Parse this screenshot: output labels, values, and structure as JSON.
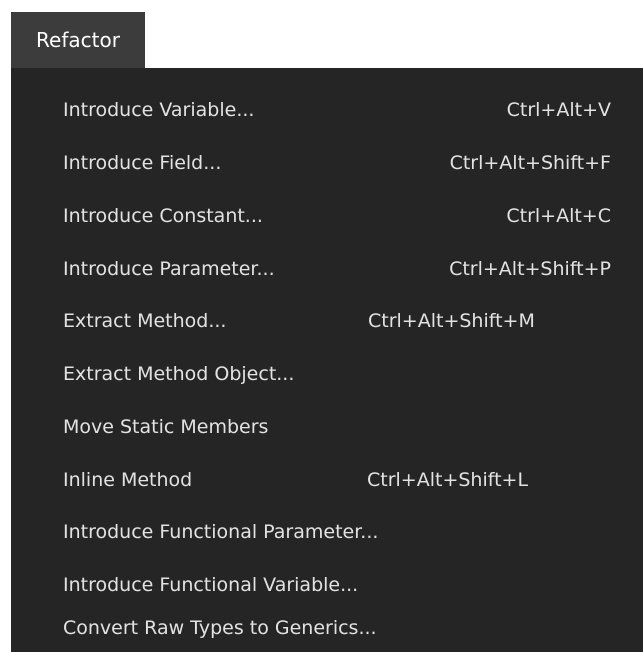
{
  "menu": {
    "title": "Refactor",
    "items": [
      {
        "label": "Introduce Variable...",
        "shortcut": "Ctrl+Alt+V"
      },
      {
        "label": "Introduce Field...",
        "shortcut": "Ctrl+Alt+Shift+F"
      },
      {
        "label": "Introduce Constant...",
        "shortcut": "Ctrl+Alt+C"
      },
      {
        "label": "Introduce Parameter...",
        "shortcut": "Ctrl+Alt+Shift+P"
      },
      {
        "label": "Extract Method...",
        "shortcut": "Ctrl+Alt+Shift+M"
      },
      {
        "label": "Extract Method Object...",
        "shortcut": ""
      },
      {
        "label": "Move Static Members",
        "shortcut": ""
      },
      {
        "label": "Inline Method",
        "shortcut": "Ctrl+Alt+Shift+L"
      },
      {
        "label": "Introduce Functional Parameter...",
        "shortcut": ""
      },
      {
        "label": "Introduce Functional Variable...",
        "shortcut": ""
      },
      {
        "label": "Convert Raw Types to Generics...",
        "shortcut": ""
      }
    ]
  },
  "colors": {
    "tab_background": "#3c3c3c",
    "panel_background": "#252525",
    "text": "#e2e2e2",
    "tab_text": "#ffffff"
  }
}
